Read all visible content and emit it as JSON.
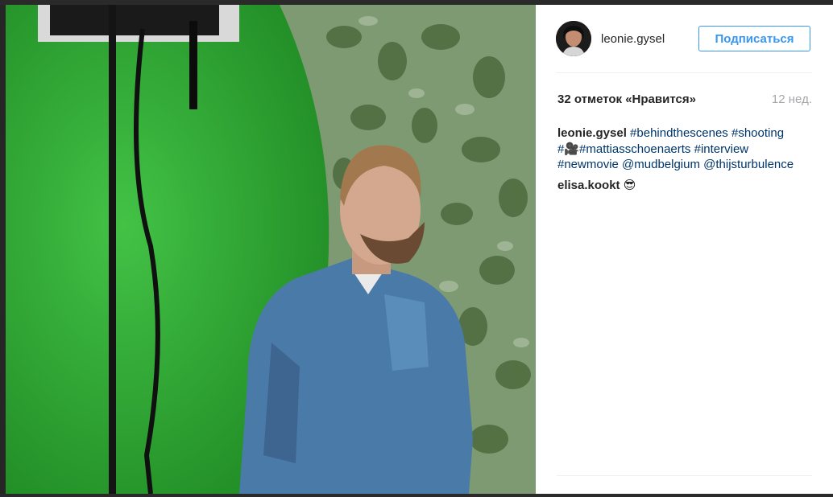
{
  "post": {
    "username": "leonie.gysel",
    "follow_label": "Подписаться",
    "likes_text": "32 отметок «Нравится»",
    "age": "12 нед.",
    "caption": {
      "username": "leonie.gysel",
      "tags_line1": "#behindthescenes #shooting",
      "tag_hash": "#",
      "camera_emoji": "🎥",
      "tags_line2": "#mattiasschoenaerts #interview",
      "tags_line3": "#newmovie @mudbelgium @thijsturbulence"
    },
    "comments": [
      {
        "username": "elisa.kookt",
        "text": "😎"
      }
    ]
  },
  "colors": {
    "accent": "#3897f0",
    "link": "#003569",
    "muted": "#a5a7aa",
    "text": "#262626",
    "green_screen": "#2ea330"
  },
  "icons": {
    "avatar": "user-avatar"
  }
}
